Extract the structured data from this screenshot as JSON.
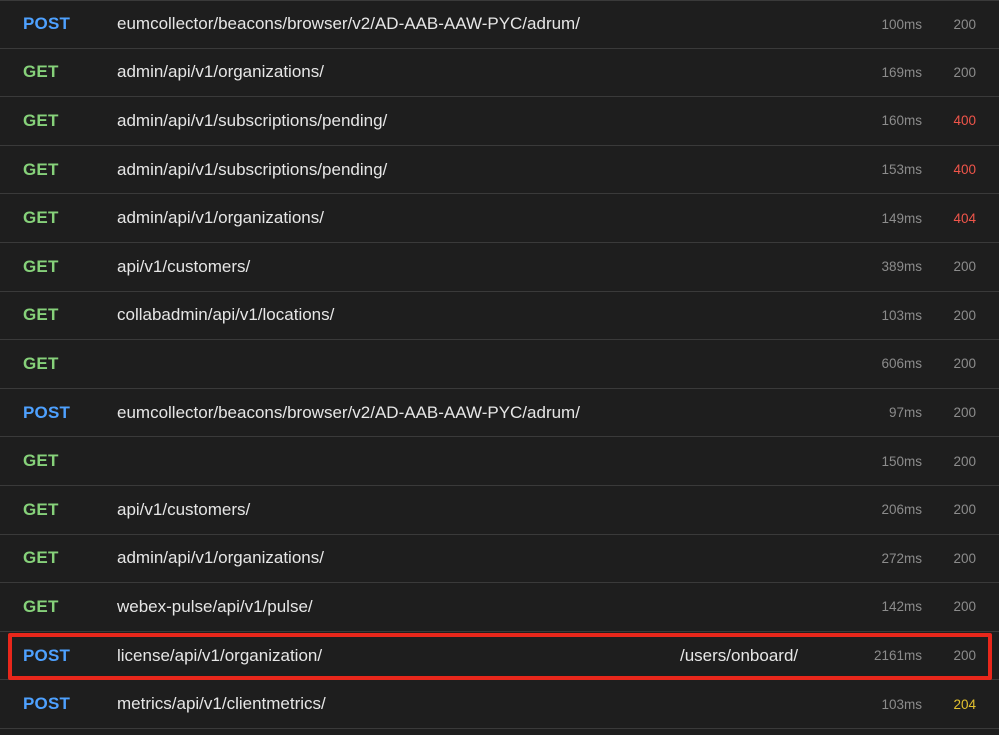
{
  "requests": [
    {
      "method": "POST",
      "path": "eumcollector/beacons/browser/v2/AD-AAB-AAW-PYC/adrum/",
      "suffix": "",
      "duration": "100ms",
      "status": "200"
    },
    {
      "method": "GET",
      "path": "admin/api/v1/organizations/",
      "suffix": "",
      "duration": "169ms",
      "status": "200"
    },
    {
      "method": "GET",
      "path": "admin/api/v1/subscriptions/pending/",
      "suffix": "",
      "duration": "160ms",
      "status": "400"
    },
    {
      "method": "GET",
      "path": "admin/api/v1/subscriptions/pending/",
      "suffix": "",
      "duration": "153ms",
      "status": "400"
    },
    {
      "method": "GET",
      "path": "admin/api/v1/organizations/",
      "suffix": "",
      "duration": "149ms",
      "status": "404"
    },
    {
      "method": "GET",
      "path": "api/v1/customers/",
      "suffix": "",
      "duration": "389ms",
      "status": "200"
    },
    {
      "method": "GET",
      "path": "collabadmin/api/v1/locations/",
      "suffix": "",
      "duration": "103ms",
      "status": "200"
    },
    {
      "method": "GET",
      "path": "",
      "suffix": "",
      "duration": "606ms",
      "status": "200"
    },
    {
      "method": "POST",
      "path": "eumcollector/beacons/browser/v2/AD-AAB-AAW-PYC/adrum/",
      "suffix": "",
      "duration": "97ms",
      "status": "200"
    },
    {
      "method": "GET",
      "path": "",
      "suffix": "",
      "duration": "150ms",
      "status": "200"
    },
    {
      "method": "GET",
      "path": "api/v1/customers/",
      "suffix": "",
      "duration": "206ms",
      "status": "200"
    },
    {
      "method": "GET",
      "path": "admin/api/v1/organizations/",
      "suffix": "",
      "duration": "272ms",
      "status": "200"
    },
    {
      "method": "GET",
      "path": "webex-pulse/api/v1/pulse/",
      "suffix": "",
      "duration": "142ms",
      "status": "200"
    },
    {
      "method": "POST",
      "path": "license/api/v1/organization/",
      "suffix": "/users/onboard/",
      "duration": "2161ms",
      "status": "200",
      "highlighted": true
    },
    {
      "method": "POST",
      "path": "metrics/api/v1/clientmetrics/",
      "suffix": "",
      "duration": "103ms",
      "status": "204"
    }
  ],
  "colors": {
    "get": "#86d17a",
    "post": "#4ea1ff",
    "status_4xx": "#f0554a",
    "status_204": "#e2c12f",
    "highlight_border": "#e8271b"
  }
}
